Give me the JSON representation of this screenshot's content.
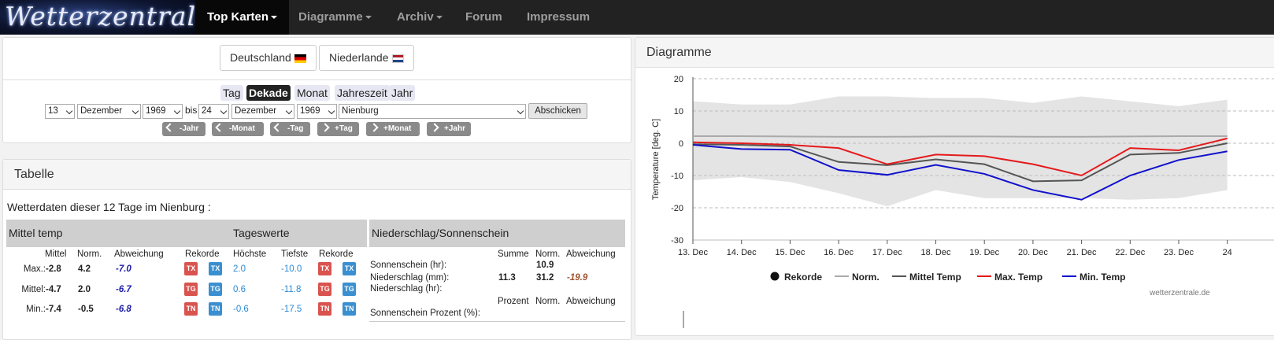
{
  "nav": {
    "logo_text": "Wetterzentrale",
    "items": [
      {
        "label": "Top Karten",
        "dropdown": true,
        "active": true
      },
      {
        "label": "Diagramme",
        "dropdown": true,
        "active": false
      },
      {
        "label": "Archiv",
        "dropdown": true,
        "active": false
      },
      {
        "label": "Forum",
        "dropdown": false,
        "active": false
      },
      {
        "label": "Impressum",
        "dropdown": false,
        "active": false
      }
    ]
  },
  "selector": {
    "countries": [
      "Deutschland",
      "Niederlande"
    ],
    "periods": [
      "Tag",
      "Dekade",
      "Monat",
      "Jahreszeit",
      "Jahr"
    ],
    "active_period": "Dekade",
    "from_day": "13",
    "from_month": "Dezember",
    "from_year": "1969",
    "bis_label": "bis",
    "to_day": "24",
    "to_month": "Dezember",
    "to_year": "1969",
    "station": "Nienburg",
    "submit": "Abschicken",
    "steps": [
      "-Jahr",
      "-Monat",
      "-Tag",
      "+Tag",
      "+Monat",
      "+Jahr"
    ]
  },
  "table": {
    "title": "Tabelle",
    "intro": "Wetterdaten dieser 12 Tage im Nienburg :",
    "header_temp": "Mittel temp",
    "header_tageswerte": "Tageswerte",
    "header_precip": "Niederschlag/Sonnenschein",
    "cols": {
      "mittel": "Mittel",
      "norm": "Norm.",
      "abw": "Abweichung",
      "rekorde": "Rekorde",
      "hoechste": "Höchste",
      "tiefste": "Tiefste",
      "rekorde2": "Rekorde"
    },
    "rows": [
      {
        "label": "Max.:",
        "mittel": "-2.8",
        "norm": "4.2",
        "abw": "-7.0",
        "rec1": "TX",
        "rec2": "TX",
        "hoechste": "2.0",
        "tiefste": "-10.0",
        "rec3": "TX",
        "rec4": "TX"
      },
      {
        "label": "Mittel:",
        "mittel": "-4.7",
        "norm": "2.0",
        "abw": "-6.7",
        "rec1": "TG",
        "rec2": "TG",
        "hoechste": "0.6",
        "tiefste": "-11.8",
        "rec3": "TG",
        "rec4": "TG"
      },
      {
        "label": "Min.:",
        "mittel": "-7.4",
        "norm": "-0.5",
        "abw": "-6.8",
        "rec1": "TN",
        "rec2": "TN",
        "hoechste": "-0.6",
        "tiefste": "-17.5",
        "rec3": "TN",
        "rec4": "TN"
      }
    ],
    "precip": {
      "col_summe": "Summe",
      "col_norm": "Norm.",
      "col_abw": "Abweichung",
      "sun_label": "Sonnenschein (hr):",
      "sun_norm": "10.9",
      "rain_label": "Niederschlag (mm):",
      "rain_summe": "11.3",
      "rain_norm": "31.2",
      "rain_abw": "-19.9",
      "rainhr_label": "Niederschlag (hr):",
      "col_prozent": "Prozent",
      "col_norm2": "Norm.",
      "col_abw2": "Abweichung",
      "sunpct_label": "Sonnenschein Prozent (%):"
    }
  },
  "chart_panel": {
    "title": "Diagramme",
    "watermark": "wetterzentrale.de"
  },
  "chart_data": {
    "type": "line",
    "title": "",
    "xlabel": "",
    "ylabel": "Temperature [deg. C]",
    "ylim": [
      -30,
      20
    ],
    "yticks": [
      20,
      10,
      0,
      -10,
      -20,
      -30
    ],
    "categories": [
      "13. Dec",
      "14. Dec",
      "15. Dec",
      "16. Dec",
      "17. Dec",
      "18. Dec",
      "19. Dec",
      "20. Dec",
      "21. Dec",
      "22. Dec",
      "23. Dec",
      "24"
    ],
    "grid": true,
    "legend_position": "bottom",
    "record_band": {
      "upper": [
        13,
        12,
        12,
        14.5,
        14.5,
        14,
        14,
        12.5,
        14.5,
        13,
        11.5,
        13.5
      ],
      "lower": [
        -11.5,
        -10.5,
        -12,
        -15.5,
        -19.5,
        -14.5,
        -17,
        -17,
        -17,
        -17.5,
        -17,
        -14.5
      ]
    },
    "series": [
      {
        "name": "Rekorde",
        "color": "#111111",
        "marker": "dot"
      },
      {
        "name": "Norm.",
        "color": "#aaaaaa",
        "values": [
          2.2,
          2.2,
          2.1,
          2.0,
          2.0,
          2.1,
          2.1,
          2.0,
          2.0,
          2.1,
          2.2,
          2.2
        ]
      },
      {
        "name": "Mittel Temp",
        "color": "#555555",
        "values": [
          -0.3,
          -0.5,
          -1.0,
          -5.8,
          -6.8,
          -5.0,
          -6.5,
          -11.8,
          -11.5,
          -3.5,
          -3.0,
          0.0
        ]
      },
      {
        "name": "Max. Temp",
        "color": "#e41a1c",
        "values": [
          0.3,
          0.0,
          -0.5,
          -1.5,
          -6.5,
          -3.5,
          -4.0,
          -6.5,
          -10.0,
          -1.5,
          -2.2,
          1.5
        ]
      },
      {
        "name": "Min. Temp",
        "color": "#1111cc",
        "values": [
          -0.5,
          -1.8,
          -2.0,
          -8.3,
          -9.8,
          -6.7,
          -9.5,
          -14.5,
          -17.5,
          -10.0,
          -5.2,
          -2.5
        ]
      }
    ]
  }
}
